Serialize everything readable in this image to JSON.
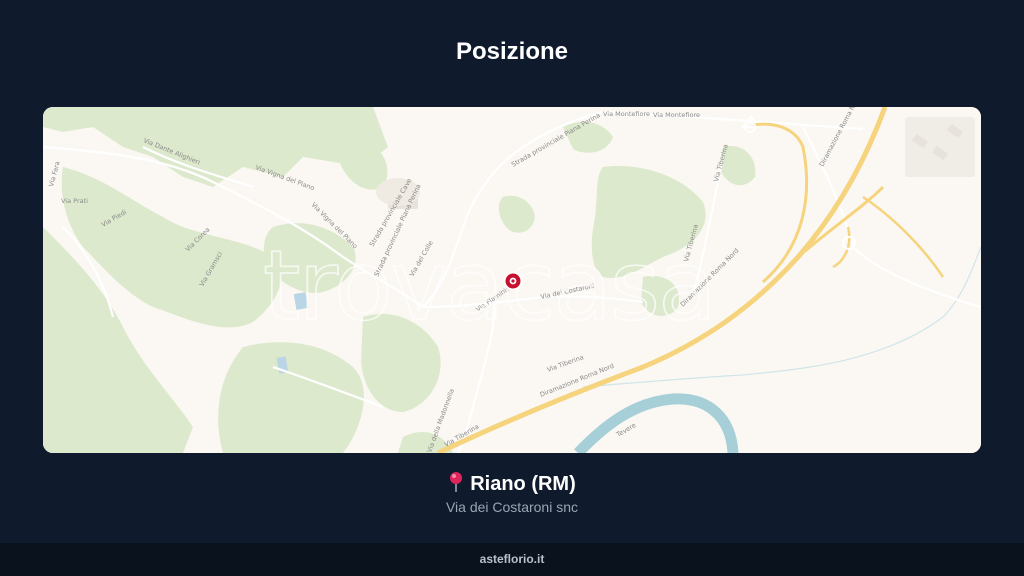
{
  "header": {
    "title": "Posizione"
  },
  "map": {
    "watermark": "trovacasa",
    "roads": {
      "via_montefiore": "Via Montefiore",
      "via_montefiore_2": "Via Montefiore",
      "via_dante_alighieri": "Via Dante Alighieri",
      "via_vigna_del_piano": "Via Vigna del Piano",
      "via_vigna_del_piano_2": "Via Vigna del Piano",
      "strada_piana_perina": "Strada provinciale Piana Perina",
      "strada_piana_perina_2": "Strada provinciale Piana Perina",
      "strada_cave": "Strada provinciale Cave",
      "via_tiberina_1": "Via Tiberina",
      "via_tiberina_2": "Via Tiberina",
      "via_tiberina_3": "Via Tiberina",
      "via_tiberina_4": "Via Tiberina",
      "dir_roma_nord_1": "Diramazione Roma Nord",
      "dir_roma_nord_2": "Diramazione Roma Nord",
      "dir_roma_nord_3": "Diramazione Roma Nord",
      "via_dei_costaroni": "Via dei Costaroni",
      "via_della_madonnella": "Via della Madonnella",
      "via_flaminia": "Via Flaminia",
      "via_fara": "Via Fara",
      "via_prati": "Via Prati",
      "via_piedi": "Via Piedi",
      "via_corea": "Via Corea",
      "via_gramsci": "Via Gramsci",
      "via_colle": "Via del Colle",
      "tevere": "Tevere"
    },
    "marker": {
      "icon": "location-marker-icon",
      "color": "#c8102e"
    }
  },
  "location": {
    "pin_icon": "pushpin-icon",
    "city": "Riano (RM)",
    "address": "Via dei Costaroni snc"
  },
  "footer": {
    "site": "asteflorio.it"
  },
  "colors": {
    "background": "#0f1a2c",
    "footer": "#0a121e",
    "map_land": "#fbf8f3",
    "map_vegetation": "#dde9cd",
    "map_motorway": "#f6d37d",
    "map_water": "#a7cfd8",
    "marker": "#c8102e"
  }
}
